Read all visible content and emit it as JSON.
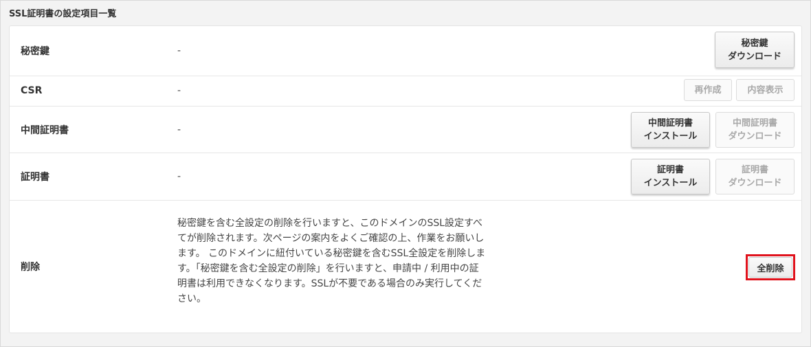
{
  "section": {
    "title": "SSL証明書の設定項目一覧"
  },
  "rows": {
    "private_key": {
      "label": "秘密鍵",
      "value": "-",
      "download_button": {
        "line1": "秘密鍵",
        "line2": "ダウンロード"
      }
    },
    "csr": {
      "label": "CSR",
      "value": "-",
      "regenerate_button": "再作成",
      "view_button": "内容表示"
    },
    "intermediate": {
      "label": "中間証明書",
      "value": "-",
      "install_button": {
        "line1": "中間証明書",
        "line2": "インストール"
      },
      "download_button": {
        "line1": "中間証明書",
        "line2": "ダウンロード"
      }
    },
    "certificate": {
      "label": "証明書",
      "value": "-",
      "install_button": {
        "line1": "証明書",
        "line2": "インストール"
      },
      "download_button": {
        "line1": "証明書",
        "line2": "ダウンロード"
      }
    },
    "delete": {
      "label": "削除",
      "description": "秘密鍵を含む全設定の削除を行いますと、このドメインのSSL設定すべてが削除されます。次ページの案内をよくご確認の上、作業をお願いします。 このドメインに紐付いている秘密鍵を含むSSL全設定を削除します。「秘密鍵を含む全設定の削除」を行いますと、申請中 / 利用中の証明書は利用できなくなります。SSLが不要である場合のみ実行してください。",
      "delete_all_button": "全削除"
    }
  },
  "colors": {
    "highlight": "#e0121c",
    "disabled_text": "#a8a8a8"
  }
}
